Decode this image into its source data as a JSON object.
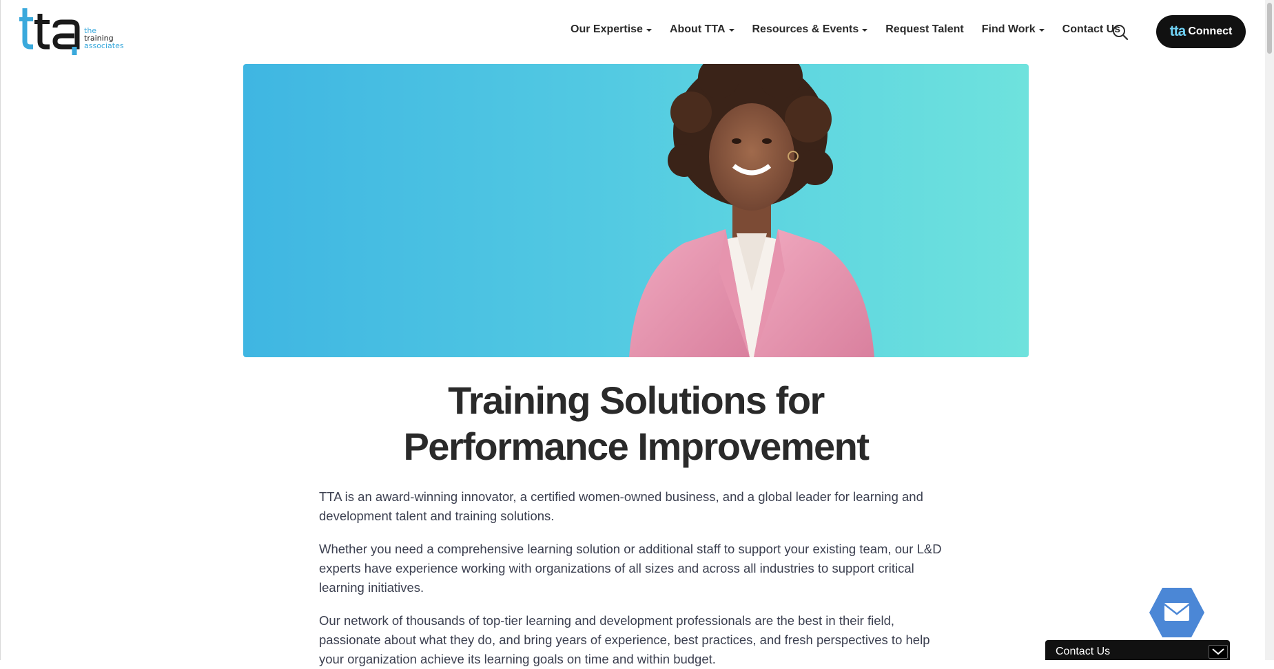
{
  "header": {
    "logo": {
      "mark_text": "tta",
      "word_lines": [
        "the",
        "training",
        "associates"
      ],
      "icon": "tta-logo"
    },
    "nav": [
      {
        "label": "Our Expertise",
        "dropdown": true
      },
      {
        "label": "About TTA",
        "dropdown": true
      },
      {
        "label": "Resources & Events",
        "dropdown": true
      },
      {
        "label": "Request Talent",
        "dropdown": false
      },
      {
        "label": "Find Work",
        "dropdown": true
      },
      {
        "label": "Contact Us",
        "dropdown": false
      }
    ],
    "search_icon": "search-icon",
    "connect": {
      "mini_logo": "tta",
      "label": "Connect"
    }
  },
  "hero": {
    "image": "woman-in-pink-blazer-photo",
    "colors": {
      "gradient_start": "#3fb6e2",
      "gradient_end": "#6ee2dd"
    }
  },
  "main": {
    "headline_line1": "Training Solutions for",
    "headline_line2": "Performance Improvement",
    "paragraphs": [
      "TTA is an award-winning innovator, a certified women-owned business, and a global leader for learning and development talent and training solutions.",
      "Whether you need a comprehensive learning solution or additional staff to support your existing team, our L&D experts have experience working with organizations of all sizes and across all industries to support critical learning initiatives.",
      "Our network of thousands of top-tier learning and development professionals are the best in their field, passionate about what they do, and bring years of experience, best practices, and fresh perspectives to help your organization achieve its learning goals on time and within budget."
    ]
  },
  "widgets": {
    "mail_fab_icon": "mail-icon",
    "contact_bar": {
      "label": "Contact Us",
      "toggle_icon": "chevron-down-icon"
    }
  },
  "colors": {
    "accent": "#3aa9dc",
    "dark": "#111111",
    "text": "#2b2b2b"
  }
}
